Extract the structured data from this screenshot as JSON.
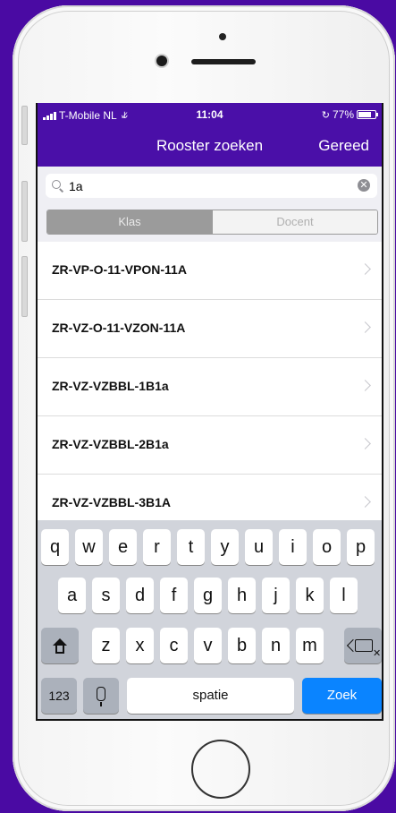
{
  "status": {
    "carrier": "T-Mobile NL",
    "time": "11:04",
    "battery": "77%",
    "battery_level": 0.77
  },
  "navbar": {
    "title": "Rooster zoeken",
    "done_label": "Gereed"
  },
  "search": {
    "value": "1a"
  },
  "segments": {
    "klas": "Klas",
    "docent": "Docent"
  },
  "results": [
    "ZR-VP-O-11-VPON-11A",
    "ZR-VZ-O-11-VZON-11A",
    "ZR-VZ-VZBBL-1B1a",
    "ZR-VZ-VZBBL-2B1a",
    "ZR-VZ-VZBBL-3B1A"
  ],
  "keyboard": {
    "row1": [
      "q",
      "w",
      "e",
      "r",
      "t",
      "y",
      "u",
      "i",
      "o",
      "p"
    ],
    "row2": [
      "a",
      "s",
      "d",
      "f",
      "g",
      "h",
      "j",
      "k",
      "l"
    ],
    "row3": [
      "z",
      "x",
      "c",
      "v",
      "b",
      "n",
      "m"
    ],
    "numbers_label": "123",
    "space_label": "spatie",
    "go_label": "Zoek"
  },
  "colors": {
    "brand": "#4a0fa8",
    "go_key": "#0a84ff"
  }
}
